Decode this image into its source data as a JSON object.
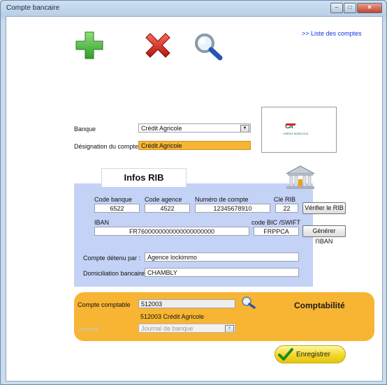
{
  "window": {
    "title": "Compte bancaire",
    "minimize": "–",
    "maximize": "□",
    "close": "✕"
  },
  "toolbar": {
    "list_link": ">> Liste des comptes"
  },
  "bank": {
    "label": "Banque",
    "value": "Crédit Agricole",
    "designation_label": "Désignation du compte",
    "designation_value": "Crédit Agricole",
    "logo_text": "CRÉDIT AGRICOLE",
    "logo_mark": "CA"
  },
  "rib": {
    "tab_label": "Infos RIB",
    "code_banque_label": "Code banque",
    "code_banque": "6522",
    "code_agence_label": "Code agence",
    "code_agence": "4522",
    "numero_label": "Numéro de compte",
    "numero": "12345678910",
    "cle_label": "Clé RIB",
    "cle": "22",
    "verify_button": "Vérifier le RIB",
    "iban_label": "IBAN",
    "iban": "FR7600000000000000000000",
    "bic_label": "code BIC /SWIFT",
    "bic": "FRPPCA",
    "generate_button": "Générer l'IBAN",
    "holder_label": "Compte détenu par :",
    "holder": "Agence lockimmo",
    "domiciliation_label": "Domiciliation bancaire:",
    "domiciliation": "CHAMBLY"
  },
  "compta": {
    "title": "Comptabilité",
    "account_label": "Compte comptable",
    "account": "512003",
    "account_desc": "512003 Crédit Agricole",
    "journal_label": "Journal",
    "journal": "Journal de banque"
  },
  "save_button": "Enregistrer",
  "colors": {
    "orange": "#f7b533",
    "blue_panel": "#c4d2f6",
    "designation_bg": "#f7b533"
  }
}
